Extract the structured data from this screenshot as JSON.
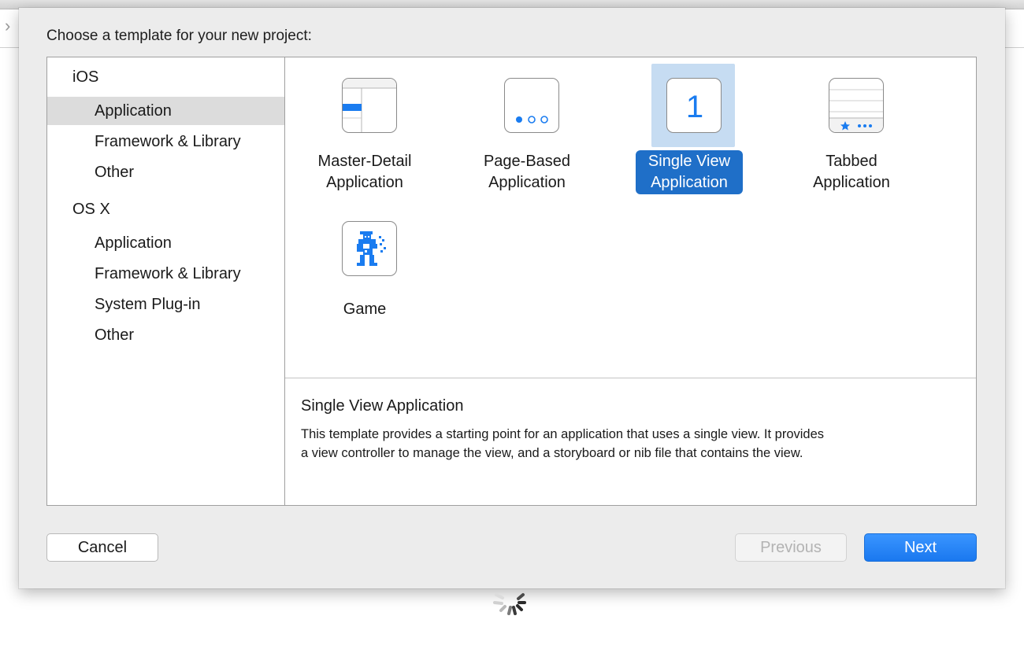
{
  "sheet": {
    "prompt": "Choose a template for your new project:"
  },
  "sidebar": {
    "groups": [
      {
        "header": "iOS",
        "items": [
          "Application",
          "Framework & Library",
          "Other"
        ]
      },
      {
        "header": "OS X",
        "items": [
          "Application",
          "Framework & Library",
          "System Plug-in",
          "Other"
        ]
      }
    ],
    "selected_group": 0,
    "selected_item": 0
  },
  "templates": [
    {
      "line1": "Master-Detail",
      "line2": "Application",
      "icon": "master-detail-icon",
      "selected": false
    },
    {
      "line1": "Page-Based",
      "line2": "Application",
      "icon": "page-based-icon",
      "selected": false
    },
    {
      "line1": "Single View",
      "line2": "Application",
      "icon": "single-view-icon",
      "icon_glyph": "1",
      "selected": true
    },
    {
      "line1": "Tabbed",
      "line2": "Application",
      "icon": "tabbed-icon",
      "selected": false
    },
    {
      "line1": "Game",
      "line2": "",
      "icon": "game-icon",
      "selected": false
    }
  ],
  "description": {
    "title": "Single View Application",
    "body_line1": "This template provides a starting point for an application that uses a single view. It provides",
    "body_line2": "a view controller to manage the view, and a storyboard or nib file that contains the view."
  },
  "buttons": {
    "cancel": "Cancel",
    "previous": "Previous",
    "next": "Next"
  },
  "colors": {
    "accent": "#1f6fc8",
    "icon_blue": "#1a7cf0",
    "selection_bg": "#c6dcf2"
  }
}
